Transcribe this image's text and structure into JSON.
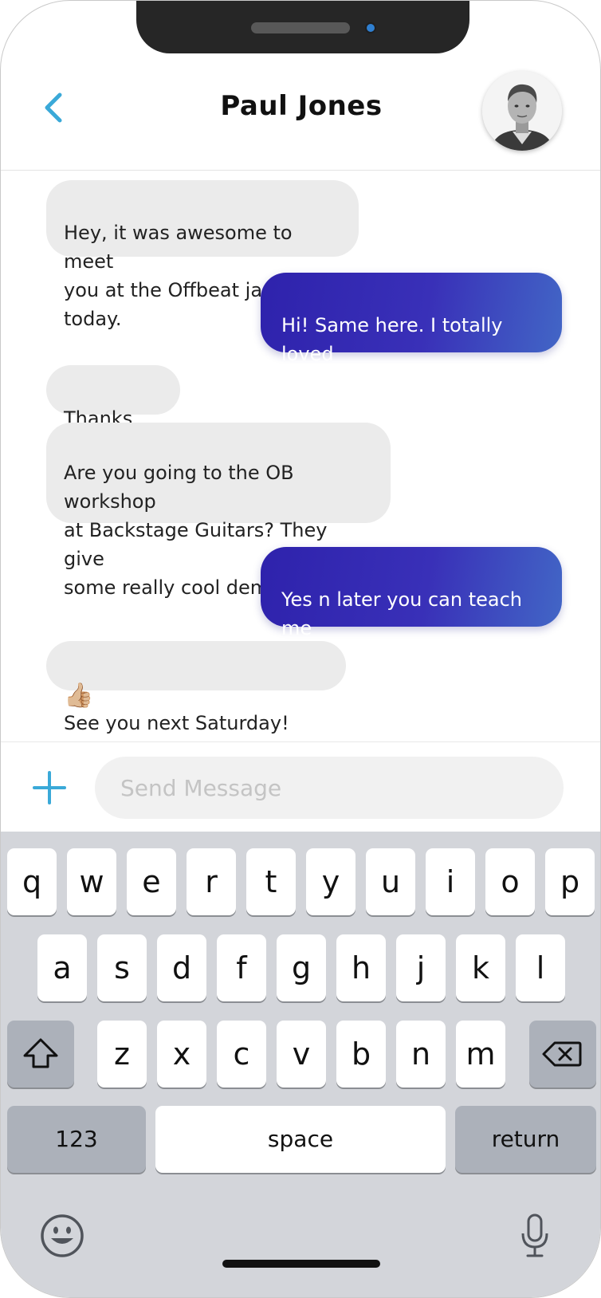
{
  "contact": {
    "name": "Paul Jones"
  },
  "messages": [
    {
      "direction": "in",
      "text": "Hey, it was awesome to meet\nyou at the Offbeat jam today."
    },
    {
      "direction": "out",
      "text": "Hi! Same here. I totally loved\nthat riff you played."
    },
    {
      "direction": "in",
      "text": "Thanks",
      "emoji": "😊"
    },
    {
      "direction": "in",
      "text": "Are you going to the OB workshop\nat Backstage Guitars? They give\nsome really cool demos."
    },
    {
      "direction": "out",
      "text": "Yes n later you can teach me\nhow to play that riff too.",
      "emoji": "😁"
    },
    {
      "direction": "in",
      "emoji": "👍🏼",
      "text": "See you next Saturday!"
    }
  ],
  "composer": {
    "placeholder": "Send Message",
    "value": ""
  },
  "keyboard": {
    "row1": [
      "q",
      "w",
      "e",
      "r",
      "t",
      "y",
      "u",
      "i",
      "o",
      "p"
    ],
    "row2": [
      "a",
      "s",
      "d",
      "f",
      "g",
      "h",
      "j",
      "k",
      "l"
    ],
    "row3": [
      "z",
      "x",
      "c",
      "v",
      "b",
      "n",
      "m"
    ],
    "numbers_label": "123",
    "space_label": "space",
    "return_label": "return"
  },
  "colors": {
    "accent": "#3aa9d8",
    "outgoing_start": "#2e22ac",
    "outgoing_end": "#4266c6",
    "incoming": "#ebebeb"
  },
  "icons": {
    "back": "chevron-left-icon",
    "attach": "plus-icon",
    "shift": "shift-icon",
    "delete": "backspace-icon",
    "emoji": "smiley-icon",
    "mic": "microphone-icon"
  }
}
